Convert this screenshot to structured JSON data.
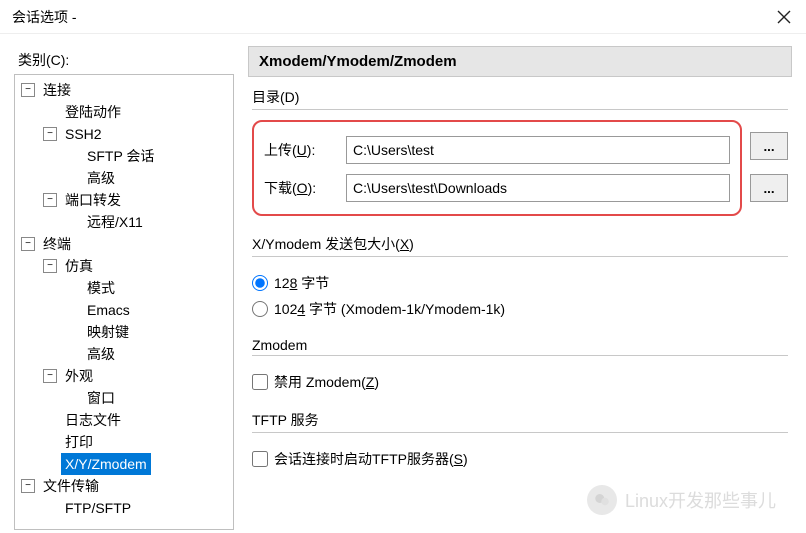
{
  "window": {
    "title": "会话选项 -"
  },
  "category_label": "类别(C):",
  "tree": [
    {
      "label": "连接",
      "depth": 0,
      "expandable": true,
      "expanded": true
    },
    {
      "label": "登陆动作",
      "depth": 1,
      "expandable": false
    },
    {
      "label": "SSH2",
      "depth": 1,
      "expandable": true,
      "expanded": true
    },
    {
      "label": "SFTP 会话",
      "depth": 2,
      "expandable": false
    },
    {
      "label": "高级",
      "depth": 2,
      "expandable": false
    },
    {
      "label": "端口转发",
      "depth": 1,
      "expandable": true,
      "expanded": true
    },
    {
      "label": "远程/X11",
      "depth": 2,
      "expandable": false
    },
    {
      "label": "终端",
      "depth": 0,
      "expandable": true,
      "expanded": true
    },
    {
      "label": "仿真",
      "depth": 1,
      "expandable": true,
      "expanded": true
    },
    {
      "label": "模式",
      "depth": 2,
      "expandable": false
    },
    {
      "label": "Emacs",
      "depth": 2,
      "expandable": false
    },
    {
      "label": "映射键",
      "depth": 2,
      "expandable": false
    },
    {
      "label": "高级",
      "depth": 2,
      "expandable": false
    },
    {
      "label": "外观",
      "depth": 1,
      "expandable": true,
      "expanded": true
    },
    {
      "label": "窗口",
      "depth": 2,
      "expandable": false
    },
    {
      "label": "日志文件",
      "depth": 1,
      "expandable": false
    },
    {
      "label": "打印",
      "depth": 1,
      "expandable": false
    },
    {
      "label": "X/Y/Zmodem",
      "depth": 1,
      "expandable": false,
      "selected": true
    },
    {
      "label": "文件传输",
      "depth": 0,
      "expandable": true,
      "expanded": true
    },
    {
      "label": "FTP/SFTP",
      "depth": 1,
      "expandable": false
    }
  ],
  "panel": {
    "heading": "Xmodem/Ymodem/Zmodem",
    "dir_group_label": "目录(D)",
    "upload_label_pre": "上传(",
    "upload_label_u": "U",
    "upload_label_post": "):",
    "upload_value": "C:\\Users\\test",
    "download_label_pre": "下载(",
    "download_label_u": "O",
    "download_label_post": "):",
    "download_value": "C:\\Users\\test\\Downloads",
    "browse_btn": "...",
    "packet_group_label_pre": "X/Ymodem 发送包大小(",
    "packet_group_label_u": "X",
    "packet_group_label_post": ")",
    "radio128_pre": "12",
    "radio128_u": "8",
    "radio128_post": " 字节",
    "radio1024_pre": "102",
    "radio1024_u": "4",
    "radio1024_post": " 字节   (Xmodem-1k/Ymodem-1k)",
    "zmodem_group_label": "Zmodem",
    "zmodem_disable_pre": "禁用 Zmodem(",
    "zmodem_disable_u": "Z",
    "zmodem_disable_post": ")",
    "tftp_group_label": "TFTP 服务",
    "tftp_start_pre": "会话连接时启动TFTP服务器(",
    "tftp_start_u": "S",
    "tftp_start_post": ")"
  },
  "watermark": "Linux开发那些事儿"
}
